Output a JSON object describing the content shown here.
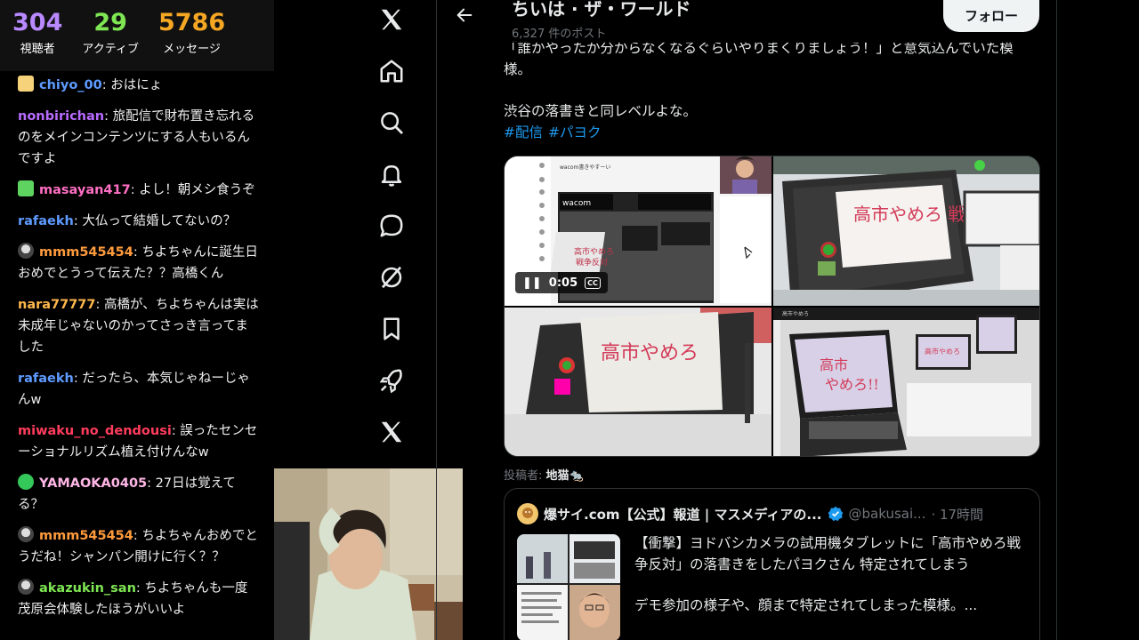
{
  "stats": [
    {
      "value": "304",
      "label": "視聴者",
      "color": "#b889ff"
    },
    {
      "value": "29",
      "label": "アクティブ",
      "color": "#7ee653"
    },
    {
      "value": "5786",
      "label": "メッセージ",
      "color": "#f5a623"
    }
  ],
  "chat": [
    {
      "user": "chiyo_00",
      "text": ": おはにょ",
      "color": "#5e9bff",
      "badge": "gift"
    },
    {
      "user": "nonbirichan",
      "text": ": 旅配信で財布置き忘れるのをメインコンテンツにする人もいるんですよ",
      "color": "#b86bff",
      "badge": ""
    },
    {
      "user": "masayan417",
      "text": ": よし！朝メシ食うぞ",
      "color": "#ff6fc4",
      "badge": "gift-green"
    },
    {
      "user": "rafaekh",
      "text": ": 大仏って結婚してないの？",
      "color": "#5e9bff",
      "badge": ""
    },
    {
      "user": "mmm545454",
      "text": ": ちよちゃんに誕生日おめでとうって伝えた？？高橋くん",
      "color": "#ff9b3d",
      "badge": "avatar"
    },
    {
      "user": "nara77777",
      "text": ": 高橋が、ちよちゃんは実は未成年じゃないのかってさっき言ってました",
      "color": "#ffb74d",
      "badge": ""
    },
    {
      "user": "rafaekh",
      "text": ": だったら、本気じゃねーじゃんw",
      "color": "#5e9bff",
      "badge": ""
    },
    {
      "user": "miwaku_no_dendousi",
      "text": ": 誤ったセンセーショナルリズム植え付けんなw",
      "color": "#ff3c5c",
      "badge": ""
    },
    {
      "user": "YAMAOKA0405",
      "text": ": 27日は覚えてる？",
      "color": "#ffb6e6",
      "badge": "verified-green"
    },
    {
      "user": "mmm545454",
      "text": ": ちよちゃんおめでとうだね！シャンパン開けに行く？？",
      "color": "#ff9b3d",
      "badge": "avatar"
    },
    {
      "user": "akazukin_san",
      "text": ": ちよちゃんも一度茂原会体験したほうがいいよ",
      "color": "#7ee653",
      "badge": "avatar"
    }
  ],
  "nav": [
    {
      "name": "x-logo-icon",
      "label": "X"
    },
    {
      "name": "home-icon",
      "label": "Home"
    },
    {
      "name": "search-icon",
      "label": "Search"
    },
    {
      "name": "bell-icon",
      "label": "Notifications"
    },
    {
      "name": "chat-bubble-icon",
      "label": "Messages"
    },
    {
      "name": "grok-icon",
      "label": "Grok"
    },
    {
      "name": "bookmark-icon",
      "label": "Bookmarks"
    },
    {
      "name": "rocket-icon",
      "label": "Jobs"
    },
    {
      "name": "x-premium-icon",
      "label": "Premium"
    }
  ],
  "header": {
    "profile_name": "ちいは · ザ・ワールド",
    "post_count": "6,327 件のポスト",
    "follow_label": "フォロー"
  },
  "tweet": {
    "line1": "「誰かやったか分からなくなるぐらいやりまくりましょう！」と意気込んでいた模様。",
    "line2": "渋谷の落書きと同レベルよな。",
    "hashtags": [
      "#配信",
      "#パヨク"
    ],
    "video_time": "0:05",
    "poster_label": "投稿者:",
    "poster_name": "地猫🐀"
  },
  "media": {
    "tile1_title": "wacom書きやすーい",
    "tile1_brand": "wacom",
    "tablet_text": "高市やめろ 戦争反対",
    "tile3_text": "高市やめろ",
    "tile4_text": "高市 やめろ!!",
    "tile4_caption": "高市やめろ"
  },
  "quote": {
    "name": "爆サイ.com【公式】報道 | マスメディアの...",
    "handle": "@bakusai...",
    "time": "· 17時間",
    "text1": "【衝撃】ヨドバシカメラの試用機タブレットに「高市やめろ戦争反対」の落書きをしたパヨクさん 特定されてしまう",
    "text2": "デモ参加の様子や、顔まで特定されてしまった模様。..."
  },
  "colors": {
    "accent": "#1d9bf0",
    "verified": "#1d9bf0"
  }
}
